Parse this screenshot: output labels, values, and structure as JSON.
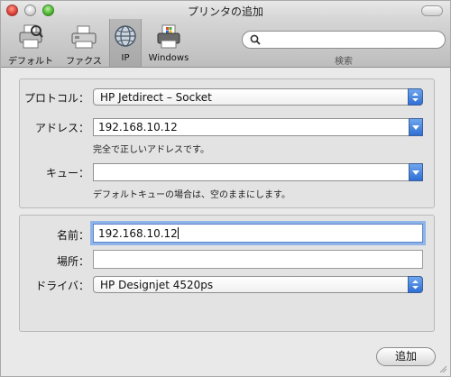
{
  "window": {
    "title": "プリンタの追加"
  },
  "toolbar": {
    "items": [
      {
        "label": "デフォルト",
        "icon": "printer-default-icon",
        "selected": false
      },
      {
        "label": "ファクス",
        "icon": "fax-icon",
        "selected": false
      },
      {
        "label": "IP",
        "icon": "ip-globe-icon",
        "selected": true
      },
      {
        "label": "Windows",
        "icon": "windows-printer-icon",
        "selected": false
      }
    ],
    "search": {
      "placeholder": "",
      "label": "検索",
      "icon": "magnifier-icon"
    }
  },
  "connection": {
    "protocol_label": "プロトコル：",
    "protocol_value": "HP Jetdirect – Socket",
    "address_label": "アドレス：",
    "address_value": "192.168.10.12",
    "address_hint": "完全で正しいアドレスです。",
    "queue_label": "キュー：",
    "queue_value": "",
    "queue_hint": "デフォルトキューの場合は、空のままにします。"
  },
  "details": {
    "name_label": "名前：",
    "name_value": "192.168.10.12",
    "location_label": "場所：",
    "location_value": "",
    "driver_label": "ドライバ：",
    "driver_value": "HP Designjet 4520ps"
  },
  "footer": {
    "add_label": "追加"
  },
  "colors": {
    "accent_blue": "#2f6fd6",
    "focus_ring": "#8fb4ea"
  }
}
